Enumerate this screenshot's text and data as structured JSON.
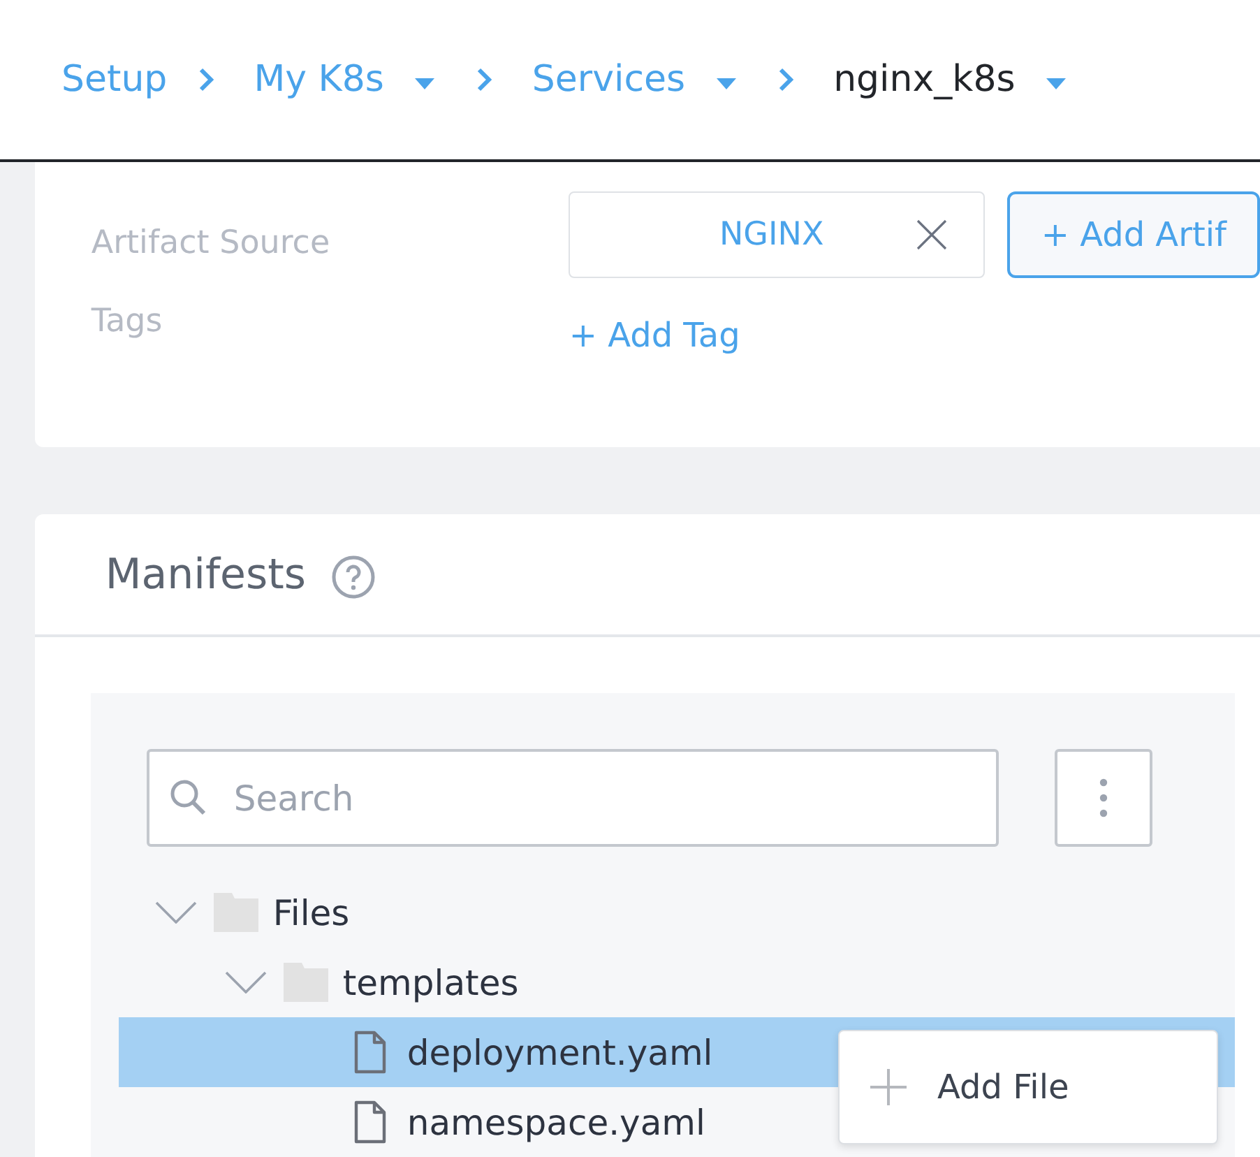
{
  "breadcrumbs": [
    {
      "label": "Setup",
      "dropdown": false,
      "current": false
    },
    {
      "label": "My K8s",
      "dropdown": true,
      "current": false
    },
    {
      "label": "Services",
      "dropdown": true,
      "current": false
    },
    {
      "label": "nginx_k8s",
      "dropdown": true,
      "current": true
    }
  ],
  "details": {
    "artifact_source_label": "Artifact Source",
    "artifact_chip": "NGINX",
    "add_artifact_button": "+ Add Artif",
    "tags_label": "Tags",
    "add_tag_link": "+ Add Tag"
  },
  "manifests": {
    "title": "Manifests",
    "search": {
      "placeholder": "Search"
    },
    "tree": [
      {
        "label": "Files",
        "kind": "folder",
        "expanded": true,
        "selected": false,
        "children": [
          {
            "label": "templates",
            "kind": "folder",
            "expanded": true,
            "selected": false,
            "children": [
              {
                "label": "deployment.yaml",
                "kind": "file",
                "selected": true
              },
              {
                "label": "namespace.yaml",
                "kind": "file",
                "selected": false
              }
            ]
          }
        ]
      }
    ],
    "context_menu": {
      "items": [
        "Add File"
      ]
    }
  }
}
